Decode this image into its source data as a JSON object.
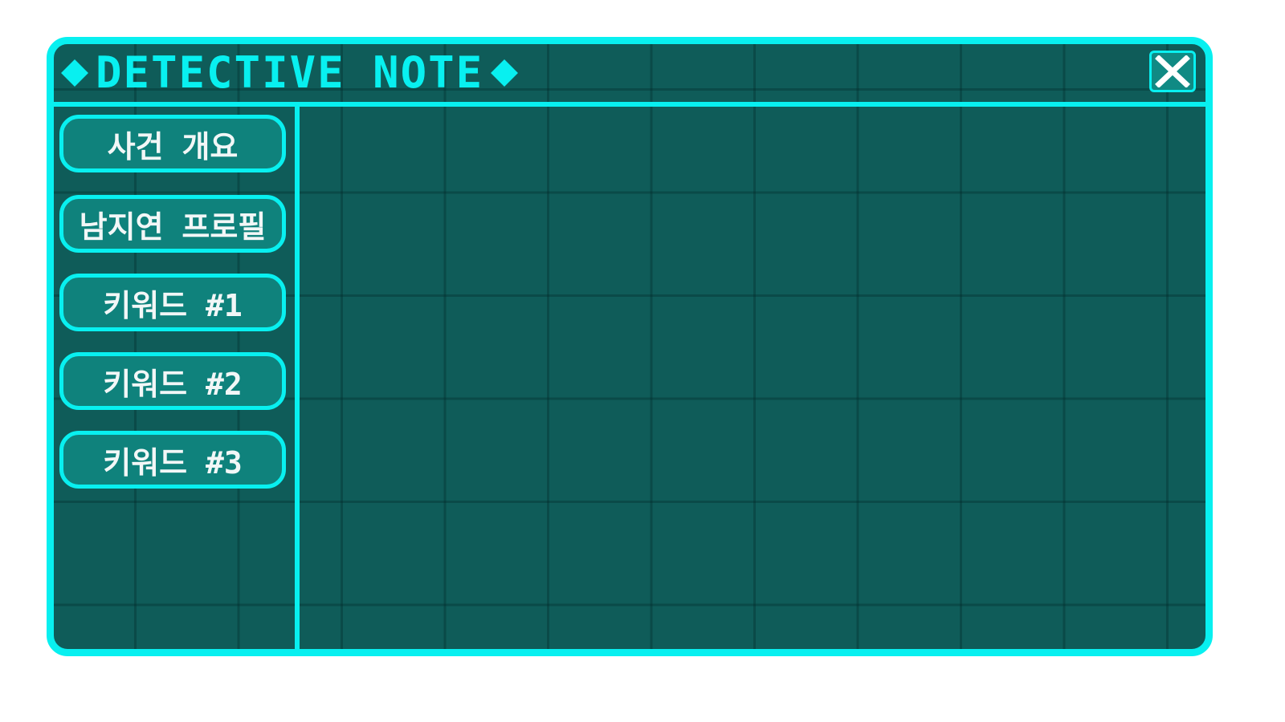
{
  "window": {
    "title": "DETECTIVE NOTE",
    "close_icon": "close-x-icon"
  },
  "sidebar": {
    "items": [
      {
        "label": "사건 개요"
      },
      {
        "label": "남지연 프로필"
      },
      {
        "label": "키워드 #1"
      },
      {
        "label": "키워드 #2"
      },
      {
        "label": "키워드 #3"
      }
    ]
  },
  "colors": {
    "accent": "#08f0f0",
    "panel_bg": "#0f5c59",
    "button_bg": "#0f827c"
  }
}
